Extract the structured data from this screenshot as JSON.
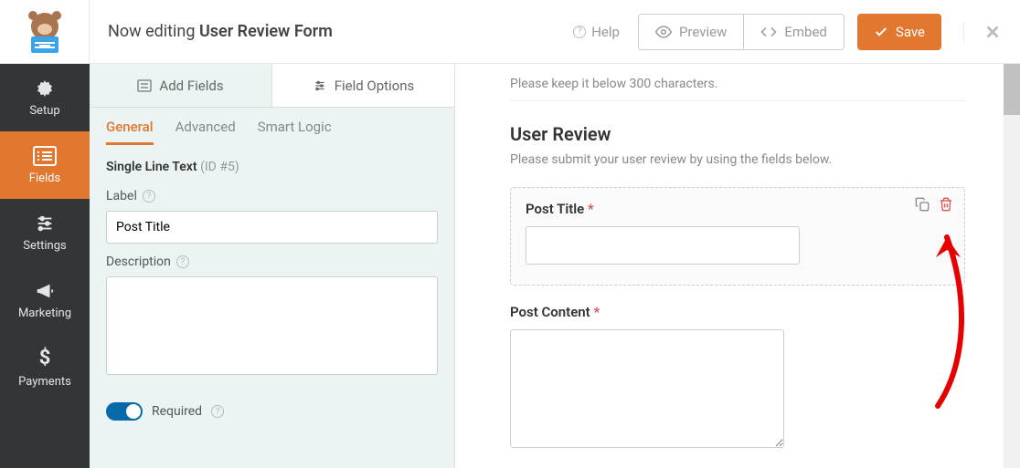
{
  "topbar": {
    "editing_prefix": "Now editing ",
    "form_name": "User Review Form",
    "help": "Help",
    "preview": "Preview",
    "embed": "Embed",
    "save": "Save"
  },
  "sidebar": {
    "setup": "Setup",
    "fields": "Fields",
    "settings": "Settings",
    "marketing": "Marketing",
    "payments": "Payments"
  },
  "leftpanel": {
    "tab_add": "Add Fields",
    "tab_options": "Field Options",
    "sub_general": "General",
    "sub_advanced": "Advanced",
    "sub_smart": "Smart Logic",
    "field_type": "Single Line Text",
    "field_id": "(ID #5)",
    "label_label": "Label",
    "label_value": "Post Title",
    "desc_label": "Description",
    "desc_value": "",
    "required_label": "Required"
  },
  "preview": {
    "char_hint": "Please keep it below 300 characters.",
    "section_title": "User Review",
    "section_desc": "Please submit your user review by using the fields below.",
    "field1_label": "Post Title",
    "asterisk": "*",
    "field2_label": "Post Content"
  }
}
